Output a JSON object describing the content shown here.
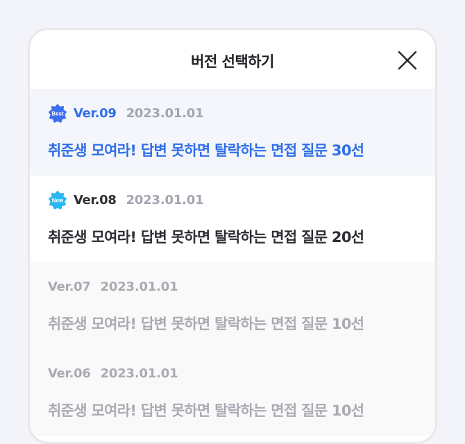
{
  "sheet": {
    "title": "버전 선택하기",
    "close_icon": "close-icon"
  },
  "versions": [
    {
      "badge": "Best",
      "badge_color": "#3b6ff0",
      "version": "Ver.09",
      "date": "2023.01.01",
      "title": "취준생 모여라! 답변 못하면 탈락하는 면접 질문 30선",
      "state": "selected"
    },
    {
      "badge": "New",
      "badge_color": "#2ab6f0",
      "version": "Ver.08",
      "date": "2023.01.01",
      "title": "취준생 모여라! 답변 못하면 탈락하는 면접 질문 20선",
      "state": "current"
    },
    {
      "version": "Ver.07",
      "date": "2023.01.01",
      "title": "취준생 모여라! 답변 못하면 탈락하는 면접 질문 10선",
      "state": "past"
    },
    {
      "version": "Ver.06",
      "date": "2023.01.01",
      "title": "취준생 모여라! 답변 못하면 탈락하는 면접 질문 10선",
      "state": "past"
    }
  ],
  "colors": {
    "accent": "#2f6ee9",
    "text_dark": "#2d2e33",
    "text_muted": "#a9abb2",
    "selected_bg": "#f4f6fb"
  }
}
